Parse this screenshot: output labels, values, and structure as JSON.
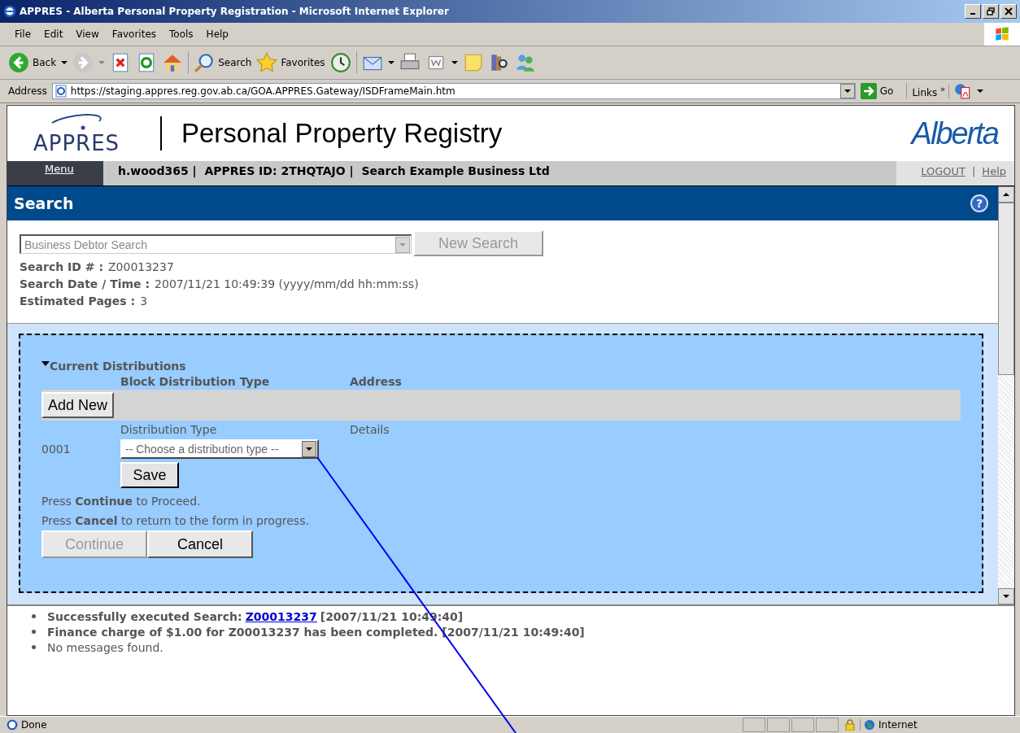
{
  "window": {
    "title": "APPRES - Alberta Personal Property Registration - Microsoft Internet Explorer"
  },
  "menu_bar": [
    "File",
    "Edit",
    "View",
    "Favorites",
    "Tools",
    "Help"
  ],
  "toolbar": {
    "back": "Back",
    "search": "Search",
    "favorites": "Favorites"
  },
  "address_bar": {
    "label": "Address",
    "url": "https://staging.appres.reg.gov.ab.ca/GOA.APPRES.Gateway/ISDFrameMain.htm",
    "go": "Go",
    "links": "Links",
    "chevron": "»"
  },
  "header": {
    "logo": "APPRES",
    "title": "Personal Property Registry",
    "brand": "Alberta"
  },
  "nav": {
    "menu": "Menu",
    "user_info": "h.wood365 |  APPRES ID: 2THQTAJO |  Search Example Business Ltd",
    "links": [
      "LOGOUT",
      "Help"
    ],
    "separator": "|"
  },
  "panel": {
    "title": "Search",
    "help": "?",
    "search_type": {
      "value": "Business Debtor Search",
      "disabled": true
    },
    "new_search": {
      "label": "New Search",
      "disabled": true
    },
    "details": [
      {
        "label": "Search ID # :",
        "value": "Z00013237"
      },
      {
        "label": "Search Date / Time :",
        "value": "2007/11/21 10:49:39 (yyyy/mm/dd hh:mm:ss)"
      },
      {
        "label": "Estimated Pages :",
        "value": "3"
      }
    ]
  },
  "distributions": {
    "heading": "Current Distributions",
    "expanded": true,
    "columns": [
      "Block Distribution Type",
      "Address"
    ],
    "add_button": "Add New",
    "form_columns": [
      "Distribution Type",
      "Details"
    ],
    "rows": [
      {
        "number": "0001",
        "type": "-- Choose a distribution type --"
      }
    ],
    "save": "Save",
    "instructions": [
      "Press **Continue** to Proceed.",
      "Press **Cancel** to return to the form in progress."
    ],
    "buttons": [
      {
        "label": "Continue",
        "disabled": true
      },
      {
        "label": "Cancel",
        "disabled": false
      }
    ]
  },
  "messages": [
    {
      "kind": "link",
      "text": "Successfully executed Search:",
      "link": "Z00013237",
      "time": "[2007/11/21 10:49:40]"
    },
    {
      "kind": "bold",
      "text": "Finance charge of $1.00 for Z00013237 has been completed. [2007/11/21 10:49:40]"
    },
    {
      "kind": "plain",
      "text": "No messages found."
    }
  ],
  "status_bar": {
    "text": "Done",
    "zone": "Internet"
  }
}
